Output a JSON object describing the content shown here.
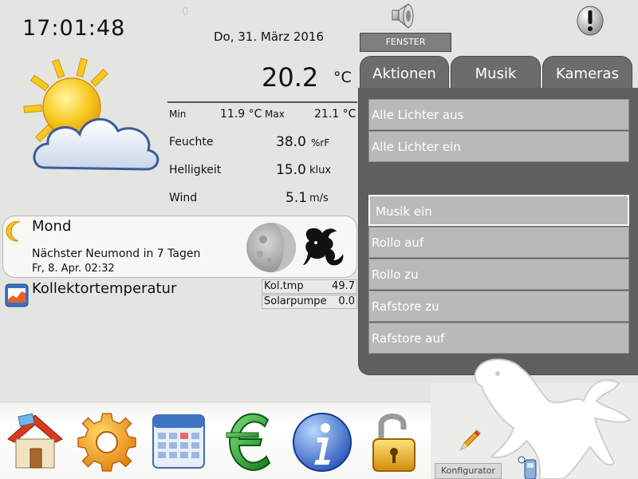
{
  "header": {
    "time": "17:01:48",
    "date": "Do, 31. März 2016",
    "tiny_value": "0",
    "fenster_button": "FENSTER"
  },
  "weather": {
    "temperature": "20.2",
    "temperature_unit": "°C",
    "min_label": "Min",
    "min_value": "11.9 °C",
    "max_label": "Max",
    "max_value": "21.1 °C",
    "rows": [
      {
        "label": "Feuchte",
        "value": "38.0",
        "unit": "%rF"
      },
      {
        "label": "Helligkeit",
        "value": "15.0",
        "unit": "klux"
      },
      {
        "label": "Wind",
        "value": "5.1",
        "unit": "m/s"
      }
    ]
  },
  "moon": {
    "title": "Mond",
    "next_new_moon": "Nächster Neumond in 7 Tagen",
    "next_date": "Fr, 8. Apr. 02:32"
  },
  "kollektor": {
    "title": "Kollektortemperatur",
    "items": [
      {
        "label": "Kol.tmp",
        "value": "49.7"
      },
      {
        "label": "Solarpumpe",
        "value": "0.0"
      }
    ]
  },
  "tabs": [
    {
      "label": "Aktionen",
      "active": true
    },
    {
      "label": "Musik",
      "active": false
    },
    {
      "label": "Kameras",
      "active": false
    }
  ],
  "actions": {
    "group1": [
      "Alle Lichter aus",
      "Alle Lichter ein"
    ],
    "group2": [
      "Musik ein",
      "Rollo auf",
      "Rollo zu",
      "Rafstore zu",
      "Rafstore auf"
    ]
  },
  "dock": {
    "icons": [
      "home-icon",
      "gear-icon",
      "calendar-icon",
      "euro-icon",
      "info-icon",
      "padlock-icon"
    ],
    "configurator_label": "Konfigurator"
  },
  "colors": {
    "tab_bg": "#6b6d6a",
    "panel_bg": "#5e605d",
    "action_bg": "#b9bab6",
    "page_bg": "#e4e5e1"
  }
}
